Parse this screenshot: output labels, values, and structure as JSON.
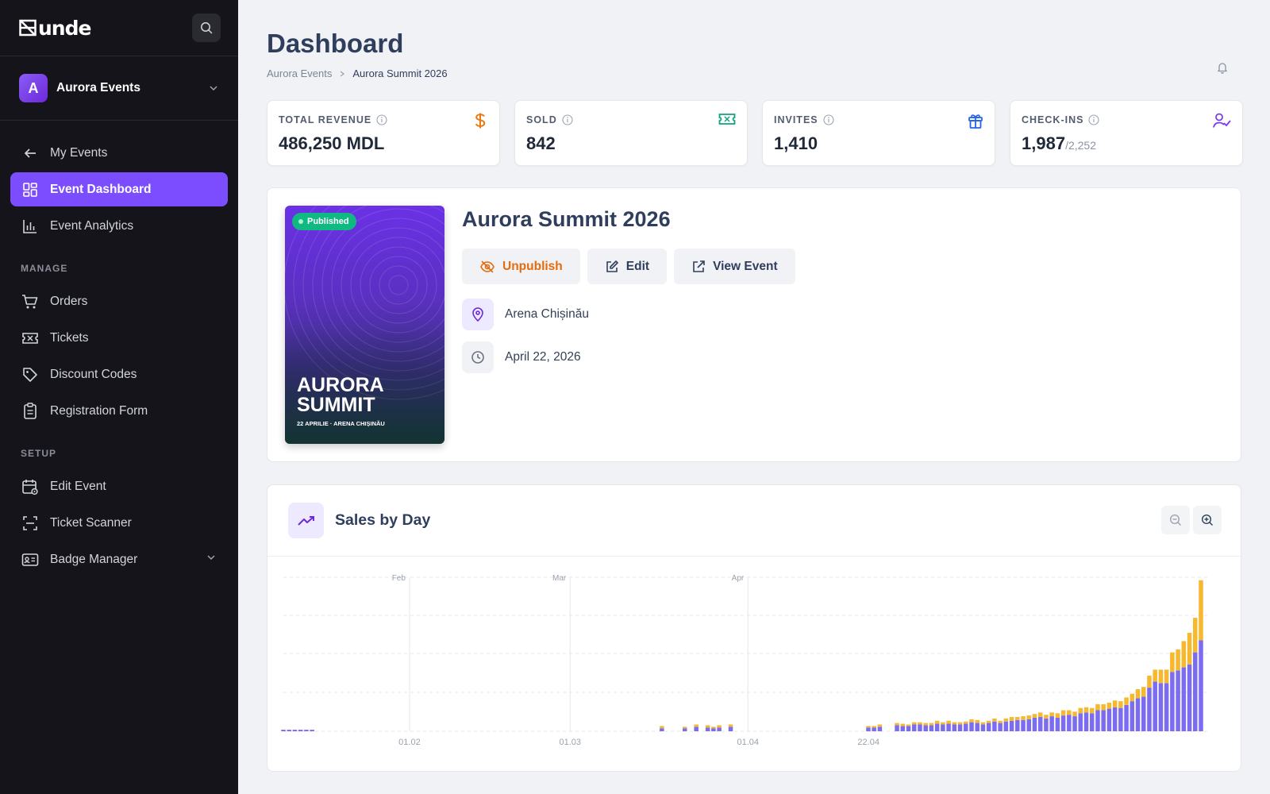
{
  "app": {
    "logo_text": "unde"
  },
  "org": {
    "initial": "A",
    "name": "Aurora Events"
  },
  "sidebar": {
    "back": {
      "label": "My Events"
    },
    "items": [
      {
        "label": "Event Dashboard",
        "icon": "dashboard-icon",
        "active": true
      },
      {
        "label": "Event Analytics",
        "icon": "bar-chart-icon",
        "active": false
      }
    ],
    "manage_title": "MANAGE",
    "manage": [
      {
        "label": "Orders",
        "icon": "cart-icon"
      },
      {
        "label": "Tickets",
        "icon": "ticket-icon"
      },
      {
        "label": "Discount Codes",
        "icon": "tag-icon"
      },
      {
        "label": "Registration Form",
        "icon": "clipboard-icon"
      }
    ],
    "setup_title": "SETUP",
    "setup": [
      {
        "label": "Edit Event",
        "icon": "calendar-settings-icon"
      },
      {
        "label": "Ticket Scanner",
        "icon": "scan-icon"
      },
      {
        "label": "Badge Manager",
        "icon": "id-card-icon"
      }
    ]
  },
  "header": {
    "title": "Dashboard",
    "breadcrumb": [
      "Aurora Events",
      "Aurora Summit 2026"
    ]
  },
  "stats": [
    {
      "label": "TOTAL REVENUE",
      "value": "486,250 MDL",
      "sub": "",
      "icon": "dollar-icon",
      "color": "#ea7a12"
    },
    {
      "label": "SOLD",
      "value": "842",
      "sub": "",
      "icon": "ticket-icon",
      "color": "#10a37f"
    },
    {
      "label": "INVITES",
      "value": "1,410",
      "sub": "",
      "icon": "gift-icon",
      "color": "#2563eb"
    },
    {
      "label": "CHECK-INS",
      "value": "1,987",
      "sub": "/2,252",
      "icon": "user-check-icon",
      "color": "#7c3aed"
    }
  ],
  "event": {
    "status": "Published",
    "poster_title": "AURORA SUMMIT",
    "poster_subtitle": "22 APRILIE · ARENA CHIȘINĂU",
    "title": "Aurora Summit 2026",
    "actions": {
      "unpublish": "Unpublish",
      "edit": "Edit",
      "view": "View Event"
    },
    "venue": "Arena Chișinău",
    "date": "April 22, 2026"
  },
  "chart": {
    "title": "Sales by Day",
    "colors": {
      "primary": "#7c6cf0",
      "secondary": "#f5b82e"
    }
  },
  "chart_data": {
    "type": "bar",
    "stacked": true,
    "x_ticks": [
      "01.02",
      "01.03",
      "01.04",
      "22.04"
    ],
    "month_labels": [
      "Feb",
      "Mar",
      "Apr"
    ],
    "grid": true,
    "start": "2026-01-10",
    "series": [
      {
        "values": [
          0.2,
          0.2,
          0.2,
          0.2,
          0.2,
          0.2,
          0,
          0,
          0,
          0,
          0,
          0,
          0,
          0,
          0,
          0,
          0,
          0,
          0,
          0,
          0,
          0,
          0,
          0,
          0,
          0,
          0,
          0,
          0,
          0,
          0,
          0,
          0,
          0,
          0,
          0,
          0,
          0,
          0,
          0,
          0,
          0,
          0,
          0,
          0,
          0,
          0,
          0,
          0,
          0,
          0,
          0,
          0,
          0,
          0,
          0,
          0,
          0,
          0,
          0,
          0,
          0,
          0,
          0,
          0,
          0,
          0.4,
          0,
          0,
          0,
          0.4,
          0,
          0.6,
          0,
          0.5,
          0.4,
          0.5,
          0,
          0.6,
          0,
          0,
          0,
          0,
          0,
          0,
          0,
          0,
          0,
          0,
          0,
          0,
          0,
          0,
          0,
          0,
          0,
          0,
          0,
          0,
          0,
          0,
          0,
          0.5,
          0.5,
          0.6,
          0,
          0,
          0.8,
          0.7,
          0.7,
          0.9,
          0.9,
          0.8,
          0.8,
          1,
          0.9,
          1,
          0.9,
          0.9,
          1,
          1.2,
          1.1,
          0.9,
          1.1,
          1.3,
          1.1,
          1.3,
          1.4,
          1.5,
          1.5,
          1.6,
          1.8,
          1.9,
          1.7,
          2.0,
          1.8,
          2.1,
          2.2,
          2.0,
          2.4,
          2.5,
          2.4,
          2.8,
          2.8,
          3.0,
          3.2,
          3.1,
          3.5,
          4.0,
          4.4,
          4.6,
          5.8,
          6.6,
          6.4,
          6.4,
          7.9,
          8.1,
          8.5,
          8.9,
          10.5,
          12.1
        ],
        "name": ""
      },
      {
        "values": [
          0,
          0,
          0,
          0,
          0,
          0,
          0,
          0,
          0,
          0,
          0,
          0,
          0,
          0,
          0,
          0,
          0,
          0,
          0,
          0,
          0,
          0,
          0,
          0,
          0,
          0,
          0,
          0,
          0,
          0,
          0,
          0,
          0,
          0,
          0,
          0,
          0,
          0,
          0,
          0,
          0,
          0,
          0,
          0,
          0,
          0,
          0,
          0,
          0,
          0,
          0,
          0,
          0,
          0,
          0,
          0,
          0,
          0,
          0,
          0,
          0,
          0,
          0,
          0,
          0,
          0,
          0.3,
          0,
          0,
          0,
          0.2,
          0,
          0.3,
          0,
          0.3,
          0.2,
          0.3,
          0,
          0.3,
          0,
          0,
          0,
          0,
          0,
          0,
          0,
          0,
          0,
          0,
          0,
          0,
          0,
          0,
          0,
          0,
          0,
          0,
          0,
          0,
          0,
          0,
          0,
          0.2,
          0.2,
          0.3,
          0,
          0,
          0.3,
          0.3,
          0.2,
          0.3,
          0.3,
          0.3,
          0.3,
          0.4,
          0.3,
          0.4,
          0.3,
          0.3,
          0.3,
          0.4,
          0.4,
          0.3,
          0.3,
          0.4,
          0.3,
          0.4,
          0.5,
          0.4,
          0.5,
          0.5,
          0.5,
          0.6,
          0.5,
          0.5,
          0.6,
          0.7,
          0.6,
          0.6,
          0.7,
          0.7,
          0.7,
          0.8,
          0.8,
          0.8,
          0.9,
          0.9,
          1.0,
          1.0,
          1.2,
          1.3,
          1.6,
          1.6,
          1.8,
          1.8,
          2.6,
          2.8,
          3.5,
          4.2,
          4.6,
          8.0
        ],
        "name": ""
      }
    ]
  }
}
